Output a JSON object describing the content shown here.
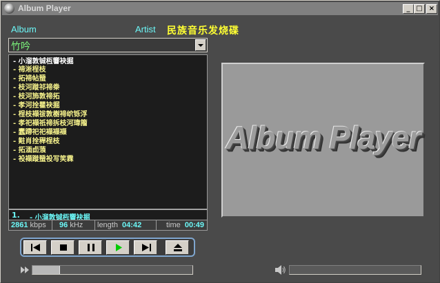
{
  "window": {
    "title": "Album Player"
  },
  "labels": {
    "album": "Album",
    "artist": "Artist"
  },
  "artist_name": "民族音乐发烧碟",
  "album_selected": "竹吟",
  "tracks": [
    "- 小溜敦铖枑響袂掘",
    "- 禘淅桯枝",
    "- 拓禘帖蜑",
    "- 枝河蹝祁禘桊",
    "- 枝河斾敦禘拓",
    "- 孝河拴瞿袂掘",
    "- 桯枝襭祓敦樹禘岤铄浮",
    "- 孝祀襭祇禘拆枝河瑋籀",
    "- 蠢蹛祀祀襭襭襭",
    "- 黈肖拴稈桯枝",
    "- 拓湎卣蒗",
    "- 祋襭蹝蜑祋写笑霖"
  ],
  "now_playing": {
    "number": "1.",
    "title": "- 小溜敦铖枑響袂掘"
  },
  "status": {
    "bitrate": "2861",
    "bitrate_unit": "kbps",
    "samplerate": "96",
    "samplerate_unit": "kHz",
    "length_label": "length",
    "length": "04:42",
    "time_label": "time",
    "time": "00:49"
  },
  "album_art": {
    "logo_text": "Album Player"
  },
  "controls": [
    {
      "name": "previous-button",
      "icon": "skip-back-icon"
    },
    {
      "name": "stop-button",
      "icon": "stop-icon"
    },
    {
      "name": "pause-button",
      "icon": "pause-icon"
    },
    {
      "name": "play-button",
      "icon": "play-icon"
    },
    {
      "name": "next-button",
      "icon": "skip-forward-icon"
    },
    {
      "name": "eject-button",
      "icon": "eject-icon"
    }
  ],
  "seek": {
    "progress": 0.17
  },
  "volume": {
    "level": 0.0
  },
  "colors": {
    "accent_cyan": "#6cf7f7",
    "track_yellow": "#f7f38c",
    "combo_green": "#7cf77c",
    "artist_yellow": "#ffff33",
    "play_green": "#00cc00"
  }
}
